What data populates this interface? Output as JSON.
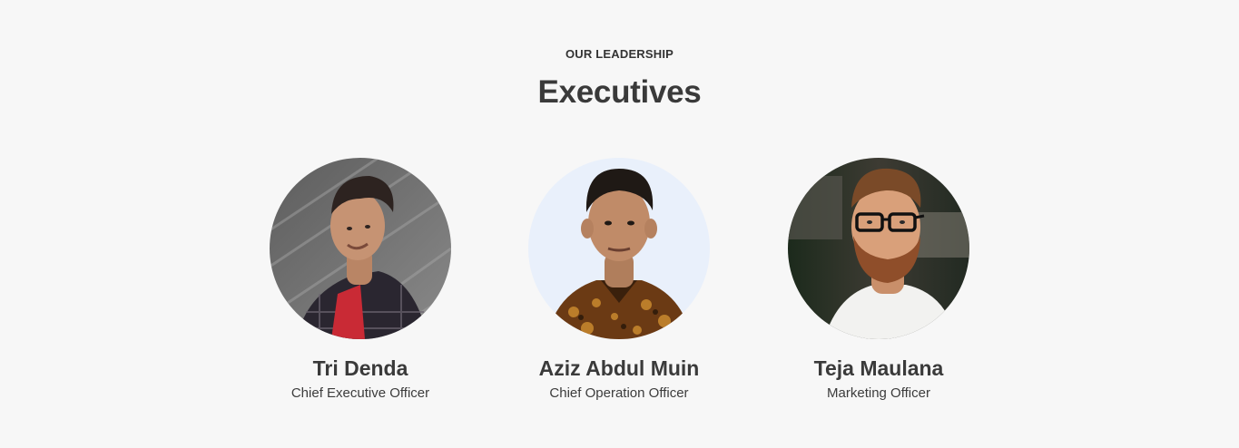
{
  "section": {
    "eyebrow": "OUR LEADERSHIP",
    "title": "Executives"
  },
  "members": [
    {
      "name": "Tri Denda",
      "role": "Chief Executive Officer"
    },
    {
      "name": "Aziz Abdul Muin",
      "role": "Chief Operation Officer"
    },
    {
      "name": "Teja Maulana",
      "role": "Marketing Officer"
    }
  ],
  "colors": {
    "background": "#f7f7f7",
    "text": "#3a3a3a"
  }
}
